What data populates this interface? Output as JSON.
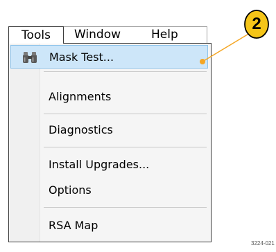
{
  "menubar": {
    "items": [
      {
        "label": "Tools"
      },
      {
        "label": "Window"
      },
      {
        "label": "Help"
      }
    ]
  },
  "dropdown": {
    "items": [
      {
        "label": "Mask Test...",
        "icon": "binoculars-icon",
        "highlighted": true
      },
      {
        "label": "Alignments"
      },
      {
        "label": "Diagnostics"
      },
      {
        "label": "Install Upgrades..."
      },
      {
        "label": "Options"
      },
      {
        "label": "RSA Map"
      }
    ]
  },
  "callout": {
    "number": "2",
    "color": "#f5c518"
  },
  "figure_id": "3224-021",
  "colors": {
    "highlight_bg": "#cde6f9",
    "highlight_border": "#8ec3ea",
    "leader_line": "#f5a623"
  }
}
